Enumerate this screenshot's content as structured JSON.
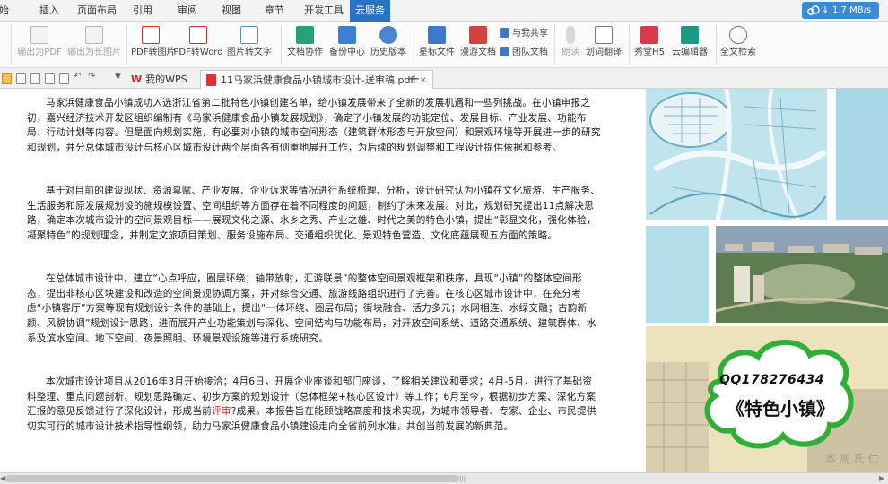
{
  "menu": {
    "tabs": [
      "开始",
      "插入",
      "页面布局",
      "引用",
      "审阅",
      "视图",
      "章节",
      "开发工具",
      "云服务"
    ],
    "active": "云服务",
    "speed": "1.7 MB/s"
  },
  "ribbon": {
    "export_pdf": "输出为PDF",
    "export_image": "输出为长图片",
    "pdf_to_image": "PDF转图片",
    "pdf_to_word": "PDF转Word",
    "image_to_text": "图片转文字",
    "doc_sync": "文档协作",
    "backup_center": "备份中心",
    "history": "历史版本",
    "starred": "星标文件",
    "roaming": "漫游文档",
    "share_with_me": "与我共享",
    "team_docs": "团队文档",
    "read_aloud": "朗读",
    "translate": "划词翻译",
    "xiutang": "秀堂H5",
    "cloud_editor": "云编辑器",
    "full_search": "全文检索"
  },
  "toolbar": {
    "tab_mywps": "我的WPS",
    "tab_doc": "11马家浜健康食品小镇城市设计-送审稿.pdf"
  },
  "document": {
    "p1": "马家浜健康食品小镇成功入选浙江省第二批特色小镇创建名单，给小镇发展带来了全新的发展机遇和一些列挑战。在小镇申报之初，嘉兴经济技术开发区组织编制有《马家浜健康食品小镇发展规划》，确定了小镇发展的功能定位、发展目标、产业发展、功能布局、行动计划等内容。但是面向规划实施，有必要对小镇的城市空间形态（建筑群体形态与开放空间）和景观环境等开展进一步的研究和规划，并分总体城市设计与核心区城市设计两个层面各有侧重地展开工作，为后续的规划调整和工程设计提供依据和参考。",
    "p2": "基于对目前的建设现状、资源禀赋、产业发展、企业诉求等情况进行系统梳理、分析，设计研究认为小镇在文化旅游、生产服务、生活服务和原发展规划设的施规模设置、空间组织等方面存在着不同程度的问题，制约了未来发展。对此，规划研究提出11点解决思路，确定本次城市设计的空间景观目标——展现文化之源、水乡之秀、产业之雄、时代之美的特色小镇，提出“彰显文化，强化体验，凝聚特色”的规划理念，并制定文旅项目策划、服务设施布局、交通组织优化、景观特色营造、文化底蕴展现五方面的策略。",
    "p3": "在总体城市设计中，建立“心点呼应，圈层环绕；轴带放射，汇游联景”的整体空间景观框架和秩序，具现“小镇”的整体空间形态，提出非核心区块建设和改造的空间景观协调方案，并对综合交通、旅游线路组织进行了完善。在核心区城市设计中，在充分考虑“小镇客厅”方案等现有规划设计条件的基础上，提出“一体环绕、圈层布局；街块融合、活力多元；水网相连、水绿交融；古韵新颜、风貌协调”规划设计思路，进而展开产业功能策划与深化、空间结构与功能布局，对开放空间系统、道路交通系统、建筑群体、水系及滨水空间、地下空间、夜景照明、环境景观设施等进行系统研究。",
    "p4_a": "本次城市设计项目从2016年3月开始接洽；4月6日，开展企业座谈和部门座谈，了解相关建议和要求；4月-5月，进行了基础资料整理、重点问题剖析、规划思路确定、初步方案的规划设计（总体框架+核心区设计）等工作；6月至今，根据初步方案、深化方案汇报的意见反馈进行了深化设计，形成当前",
    "p4_hl": "评审",
    "p4_b": "?成果。本报告旨在能顾战略高度和技术实现，为城市领导者、专家、企业、市民提供切实可行的城市设计技术指导性纲领，助力马家浜健康食品小镇建设走向全省前列水准，共创当前发展的新典范。"
  },
  "badge": {
    "qq": "QQ178276434",
    "title": "《特色小镇》"
  },
  "colors": {
    "accent": "#2b71c4",
    "highlight": "#d02525"
  }
}
